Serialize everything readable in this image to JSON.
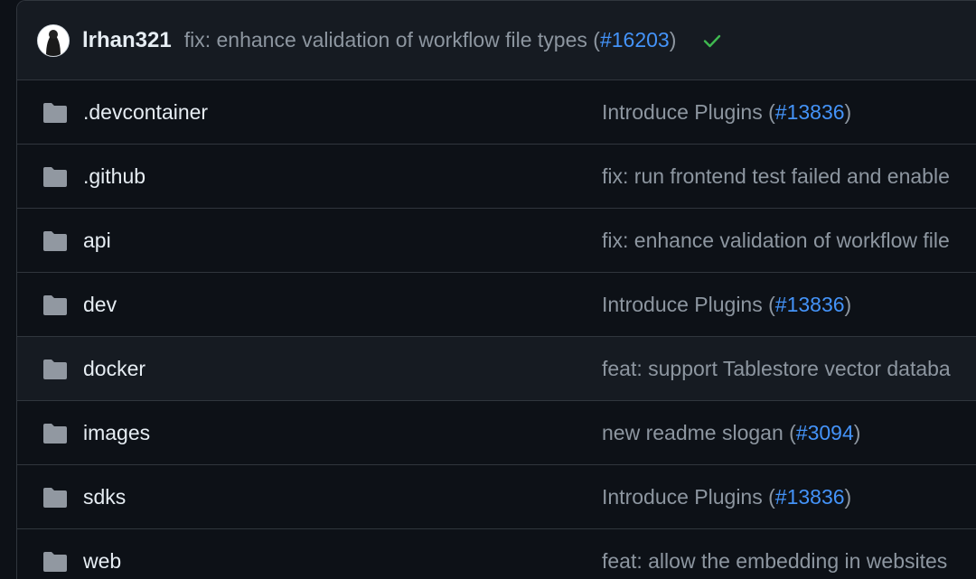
{
  "commit": {
    "author": "lrhan321",
    "message_prefix": "fix: enhance validation of workflow file types (",
    "pr": "#16203",
    "message_suffix": ")",
    "status_icon": "check-icon",
    "status_color": "#3fb950"
  },
  "colors": {
    "background": "#0d1117",
    "header_bg": "#161b22",
    "border": "#30363d",
    "text": "#e6edf3",
    "muted": "#8d96a0",
    "link": "#4493f8",
    "folder_icon": "#9198a1"
  },
  "files": [
    {
      "name": ".devcontainer",
      "icon": "folder-icon",
      "msg_prefix": "Introduce Plugins (",
      "pr": "#13836",
      "msg_suffix": ")"
    },
    {
      "name": ".github",
      "icon": "folder-icon",
      "msg_prefix": "fix: run frontend test failed and enable",
      "pr": "",
      "msg_suffix": ""
    },
    {
      "name": "api",
      "icon": "folder-icon",
      "msg_prefix": "fix: enhance validation of workflow file",
      "pr": "",
      "msg_suffix": ""
    },
    {
      "name": "dev",
      "icon": "folder-icon",
      "msg_prefix": "Introduce Plugins (",
      "pr": "#13836",
      "msg_suffix": ")"
    },
    {
      "name": "docker",
      "icon": "folder-icon",
      "msg_prefix": "feat: support Tablestore vector databa",
      "pr": "",
      "msg_suffix": ""
    },
    {
      "name": "images",
      "icon": "folder-icon",
      "msg_prefix": "new readme slogan (",
      "pr": "#3094",
      "msg_suffix": ")"
    },
    {
      "name": "sdks",
      "icon": "folder-icon",
      "msg_prefix": "Introduce Plugins (",
      "pr": "#13836",
      "msg_suffix": ")"
    },
    {
      "name": "web",
      "icon": "folder-icon",
      "msg_prefix": "feat: allow the embedding in websites",
      "pr": "",
      "msg_suffix": ""
    }
  ]
}
